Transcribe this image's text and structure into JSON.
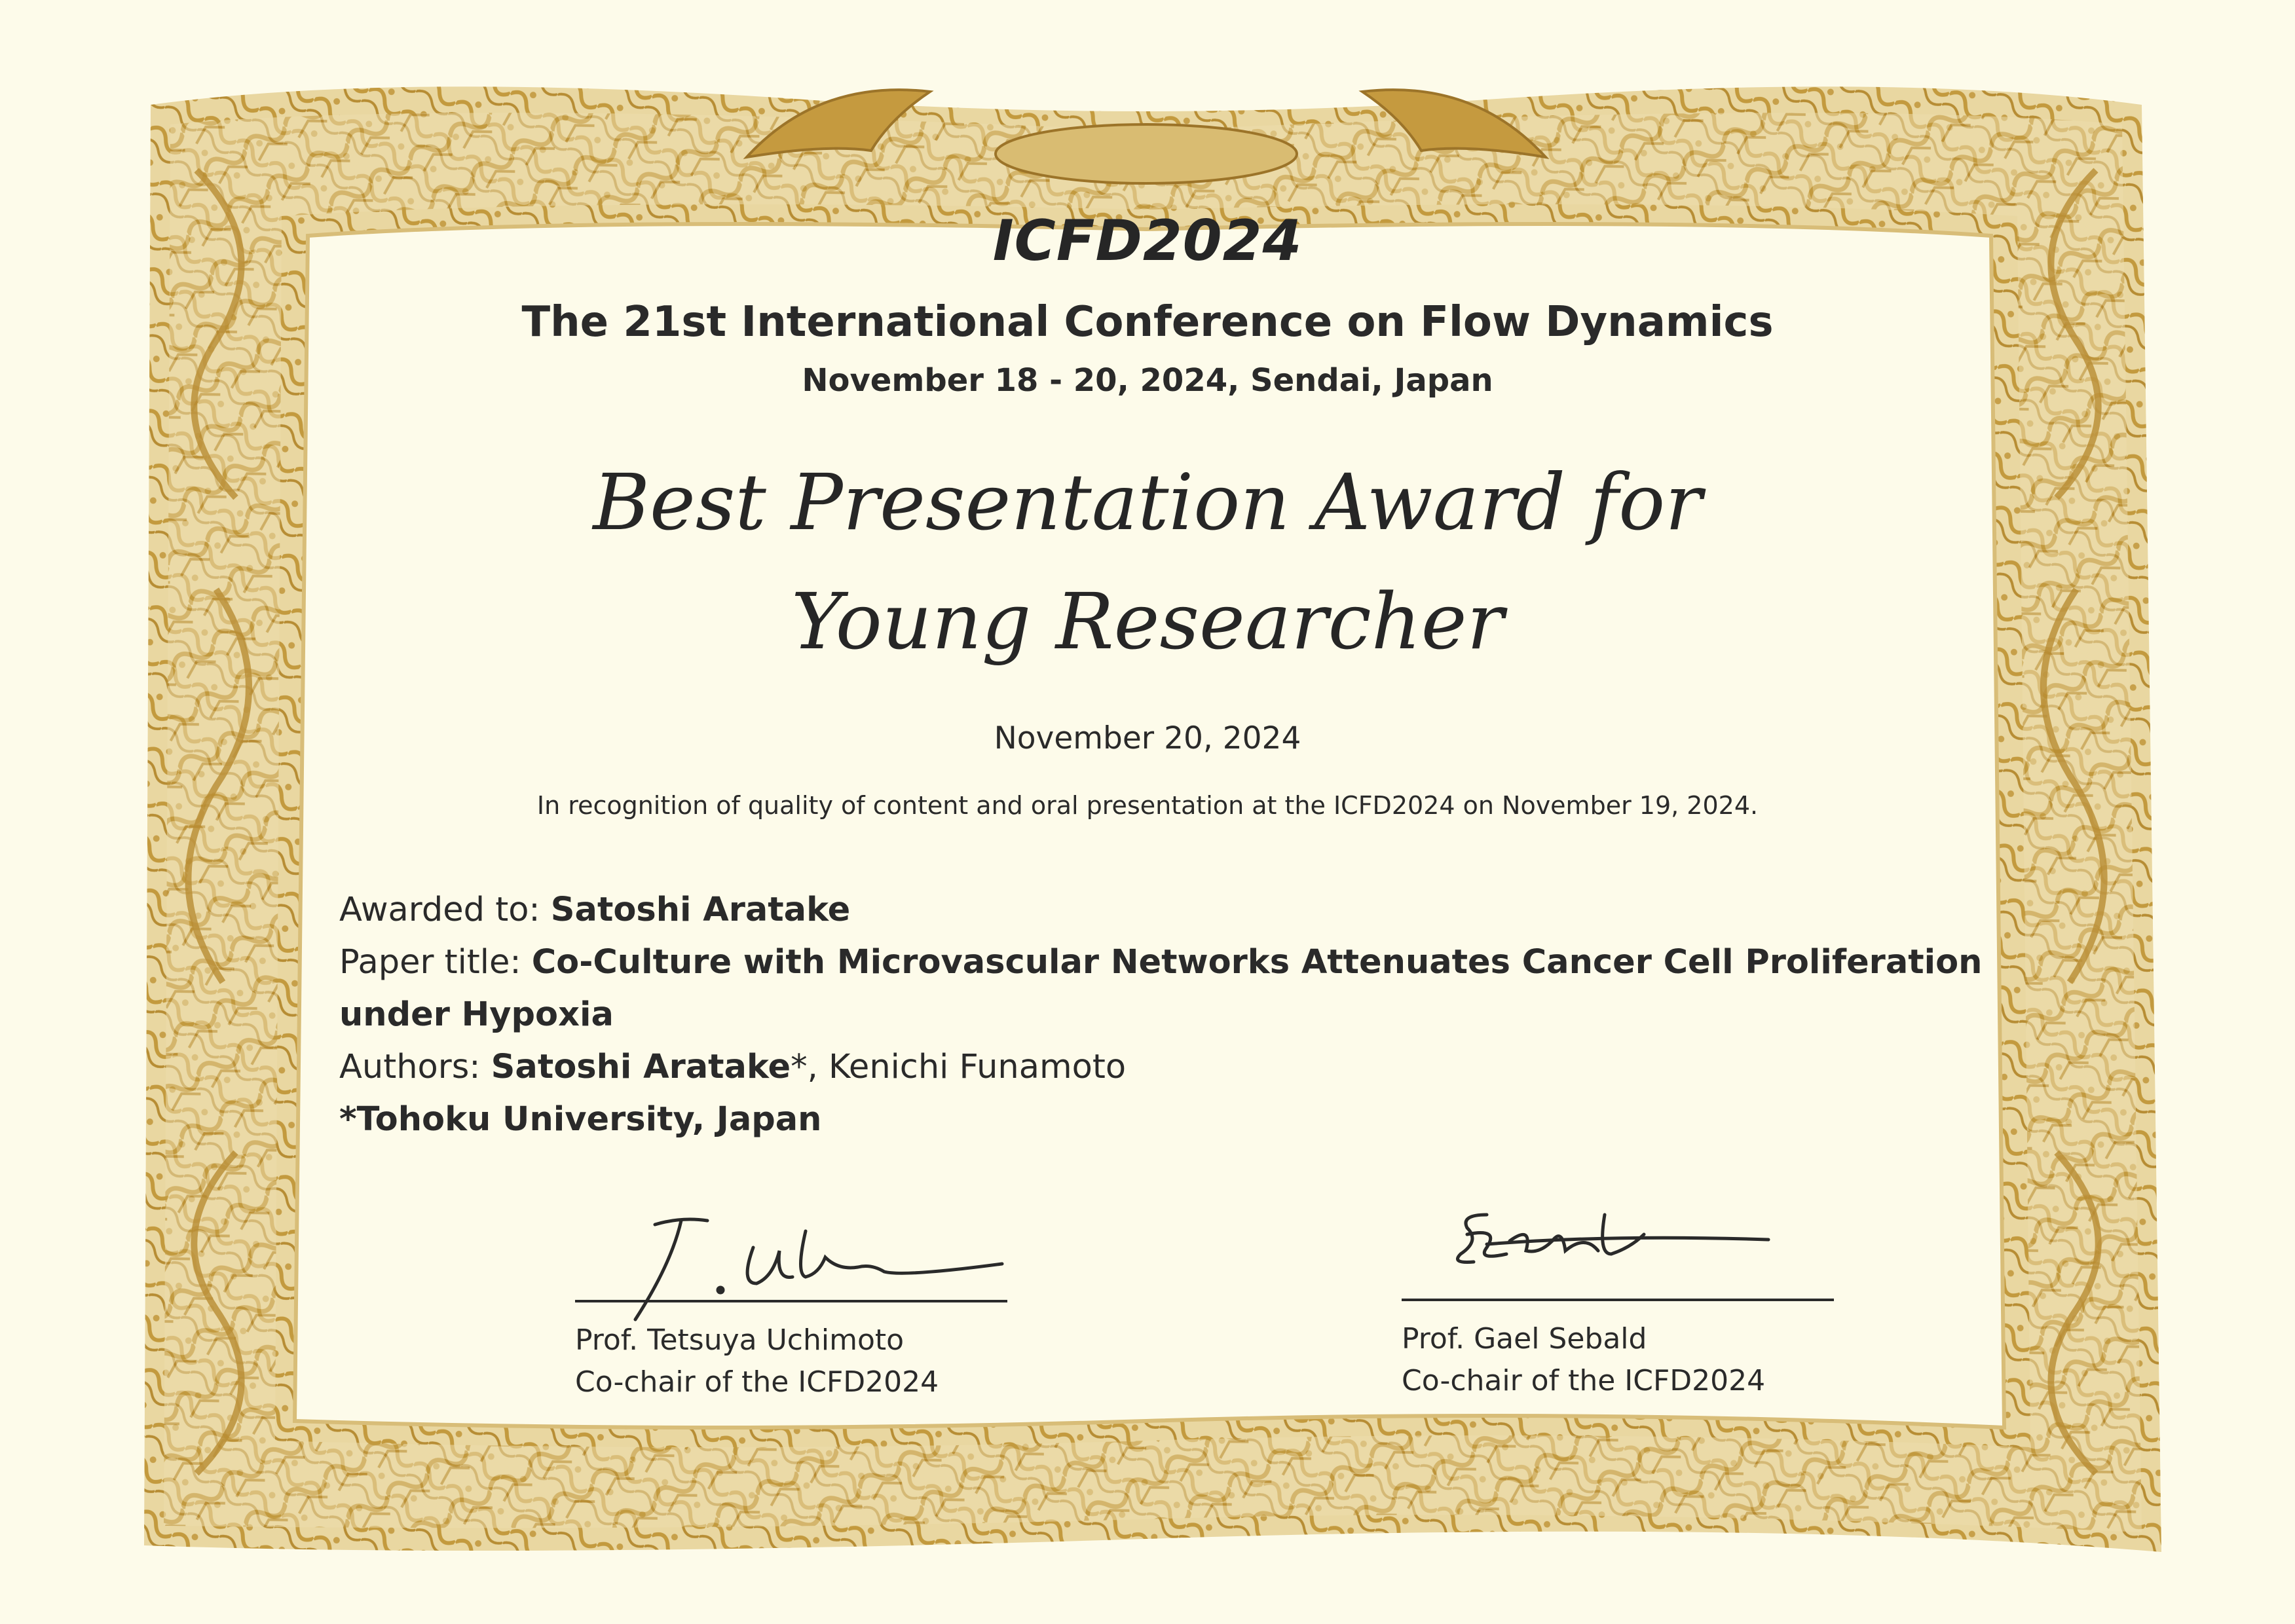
{
  "conference": {
    "code": "ICFD2024",
    "name": "The 21st International Conference on Flow Dynamics",
    "dates_place": "November 18 - 20, 2024, Sendai, Japan"
  },
  "award": {
    "title_line1": "Best Presentation Award for",
    "title_line2": "Young Researcher",
    "date": "November 20, 2024",
    "recognition": "In recognition of quality of content and oral presentation at the ICFD2024 on November 19, 2024."
  },
  "details": {
    "awarded_label": "Awarded to: ",
    "awarded_name": "Satoshi Aratake",
    "paper_label": "Paper title: ",
    "paper_title_line1": "Co-Culture with Microvascular Networks Attenuates Cancer Cell Proliferation",
    "paper_title_line2": "under Hypoxia",
    "authors_label": "Authors: ",
    "author_main": "Satoshi Aratake",
    "author_main_mark": "*",
    "author_other": ", Kenichi Funamoto",
    "affiliation": "*Tohoku University, Japan"
  },
  "signatories": [
    {
      "name": "Prof. Tetsuya Uchimoto",
      "role": "Co-chair of the ICFD2024"
    },
    {
      "name": "Prof. Gael Sebald",
      "role": "Co-chair of the ICFD2024"
    }
  ],
  "colors": {
    "paper": "#fdfbea",
    "border_gold": "#c9a24a",
    "border_light": "#e8d39a",
    "ink": "#2a2a2a"
  }
}
